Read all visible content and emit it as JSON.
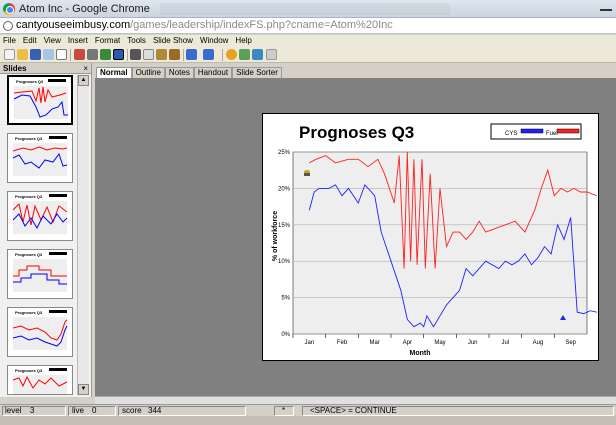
{
  "window": {
    "title": "Atom Inc - Google Chrome",
    "url_domain": "cantyouseeimbusy.com",
    "url_path": "/games/leadership/indexFS.php?cname=Atom%20Inc"
  },
  "menu": [
    "File",
    "Edit",
    "View",
    "Insert",
    "Format",
    "Tools",
    "Slide Show",
    "Window",
    "Help"
  ],
  "slides_panel": {
    "label": "Slides",
    "close": "×"
  },
  "view_tabs": [
    "Normal",
    "Outline",
    "Notes",
    "Handout",
    "Slide Sorter"
  ],
  "thumbnail_title": "Prognoses Q3",
  "chart_data": {
    "type": "line",
    "title": "Prognoses Q3",
    "xlabel": "Month",
    "ylabel": "% of workforce",
    "ylim": [
      0,
      25
    ],
    "yticks": [
      "0%",
      "5%",
      "10%",
      "15%",
      "20%",
      "25%"
    ],
    "months": [
      "Jan",
      "Feb",
      "Mar",
      "Apr",
      "May",
      "Jun",
      "Jul",
      "Aug",
      "Sep"
    ],
    "legend": "top-right",
    "series": [
      {
        "name": "CYS",
        "color": "#2020ff",
        "x": [
          0.0,
          0.15,
          0.3,
          0.6,
          0.8,
          1.0,
          1.2,
          1.5,
          1.7,
          2.0,
          2.2,
          2.5,
          2.8,
          3.0,
          3.2,
          3.4,
          3.5,
          3.6,
          3.8,
          4.0,
          4.2,
          4.6,
          4.8,
          5.0,
          5.4,
          5.8,
          6.0,
          6.2,
          6.4,
          6.6,
          6.8,
          7.0,
          7.2,
          7.4,
          7.6,
          7.8,
          8.0,
          8.2,
          8.4,
          8.6,
          8.8
        ],
        "y": [
          17,
          19.5,
          20,
          20,
          20.5,
          19,
          20,
          18,
          20.5,
          19,
          14,
          10,
          6,
          2,
          1,
          1.5,
          1,
          2.5,
          1,
          2.5,
          4,
          6,
          9,
          8,
          10,
          9,
          10,
          9.5,
          10,
          11,
          9.5,
          10.5,
          12,
          11,
          15,
          13,
          16,
          3,
          2.8,
          3.2,
          3
        ]
      },
      {
        "name": "Fuel",
        "color": "#ff2020",
        "x": [
          0.0,
          0.2,
          0.5,
          0.8,
          1.2,
          1.5,
          1.8,
          2.1,
          2.3,
          2.6,
          2.75,
          2.9,
          3.0,
          3.1,
          3.2,
          3.3,
          3.45,
          3.55,
          3.7,
          3.85,
          4.0,
          4.2,
          4.4,
          4.6,
          4.8,
          5.0,
          5.2,
          5.4,
          5.7,
          6.0,
          6.3,
          6.6,
          6.9,
          7.1,
          7.3,
          7.5,
          7.7,
          7.9,
          8.1,
          8.3,
          8.5,
          8.8
        ],
        "y": [
          23.5,
          24,
          24.5,
          23.5,
          24,
          24,
          23,
          24,
          22,
          18,
          24.5,
          9,
          25,
          10,
          24,
          9.5,
          24,
          9,
          22,
          9,
          20,
          12,
          14,
          14,
          13,
          14,
          15.5,
          14,
          14.5,
          15,
          15.5,
          14,
          17,
          20,
          22.5,
          19,
          20,
          19.5,
          20,
          19.5,
          19.5,
          19
        ]
      }
    ]
  },
  "status": {
    "level_label": "level",
    "level_value": "3",
    "live_label": "live",
    "live_value": "0",
    "score_label": "score",
    "score_value": "344",
    "star": "*",
    "continue_text": "<SPACE> = CONTINUE"
  }
}
